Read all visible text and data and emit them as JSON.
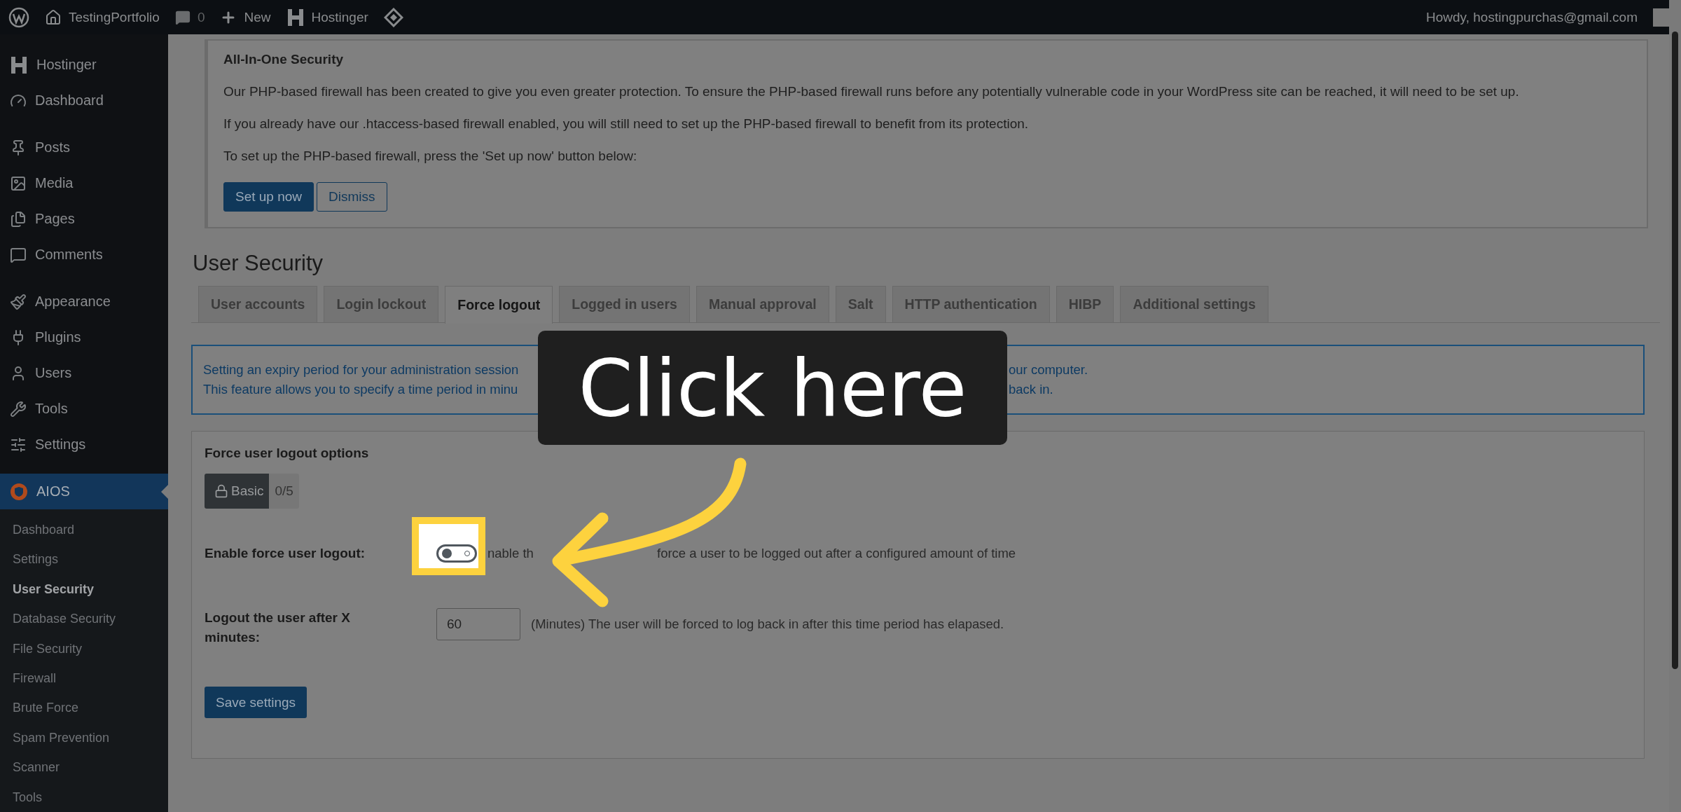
{
  "admin_bar": {
    "site": "TestingPortfolio",
    "comments": "0",
    "new": "New",
    "hostinger": "Hostinger",
    "greeting": "Howdy, hostingpurchas@gmail.com"
  },
  "sidebar": {
    "groups": [
      [
        {
          "label": "Hostinger",
          "selected": false
        },
        {
          "label": "Dashboard",
          "selected": false
        }
      ],
      [
        {
          "label": "Posts",
          "selected": false
        },
        {
          "label": "Media",
          "selected": false
        },
        {
          "label": "Pages",
          "selected": false
        },
        {
          "label": "Comments",
          "selected": false
        }
      ],
      [
        {
          "label": "Appearance",
          "selected": false
        },
        {
          "label": "Plugins",
          "selected": false
        },
        {
          "label": "Users",
          "selected": false
        },
        {
          "label": "Tools",
          "selected": false
        },
        {
          "label": "Settings",
          "selected": false
        }
      ],
      [
        {
          "label": "AIOS",
          "selected": true,
          "children": [
            {
              "label": "Dashboard",
              "selected": false
            },
            {
              "label": "Settings",
              "selected": false
            },
            {
              "label": "User Security",
              "selected": true
            },
            {
              "label": "Database Security",
              "selected": false
            },
            {
              "label": "File Security",
              "selected": false
            },
            {
              "label": "Firewall",
              "selected": false
            },
            {
              "label": "Brute Force",
              "selected": false
            },
            {
              "label": "Spam Prevention",
              "selected": false
            },
            {
              "label": "Scanner",
              "selected": false
            },
            {
              "label": "Tools",
              "selected": false
            }
          ]
        }
      ]
    ]
  },
  "notice": {
    "title": "All-In-One Security",
    "paragraphs": [
      "Our PHP-based firewall has been created to give you even greater protection. To ensure the PHP-based firewall runs before any potentially vulnerable code in your WordPress site can be reached, it will need to be set up.",
      "If you already have our .htaccess-based firewall enabled, you will still need to set up the PHP-based firewall to benefit from its protection.",
      "To set up the PHP-based firewall, press the 'Set up now' button below:"
    ],
    "buttons": [
      {
        "label": "Set up now",
        "kind": "primary"
      },
      {
        "label": "Dismiss",
        "kind": "secondary"
      }
    ]
  },
  "page_title": "User Security",
  "tabs": [
    {
      "label": "User accounts",
      "selected": false
    },
    {
      "label": "Login lockout",
      "selected": false
    },
    {
      "label": "Force logout",
      "selected": true
    },
    {
      "label": "Logged in users",
      "selected": false
    },
    {
      "label": "Manual approval",
      "selected": false
    },
    {
      "label": "Salt",
      "selected": false
    },
    {
      "label": "HTTP authentication",
      "selected": false
    },
    {
      "label": "HIBP",
      "selected": false
    },
    {
      "label": "Additional settings",
      "selected": false
    }
  ],
  "info": {
    "lines": [
      {
        "left": "Setting an expiry period for your administration session",
        "right": "our computer."
      },
      {
        "left": "This feature allows you to specify a time period in minu",
        "right": "back in."
      }
    ]
  },
  "panel": {
    "title": "Force user logout options",
    "badge": {
      "label": "Basic",
      "count": "0/5"
    },
    "fields": [
      {
        "kind": "toggle",
        "label": "Enable force user logout:",
        "checked": false,
        "description_parts": [
          "nable th",
          "force a user to be logged out after a configured amount of time"
        ]
      },
      {
        "kind": "number",
        "label": "Logout the user after X minutes:",
        "value": "60",
        "description": "(Minutes) The user will be forced to log back in after this time period has elapased."
      }
    ],
    "save": "Save settings"
  },
  "tour": {
    "callout": "Click here"
  }
}
